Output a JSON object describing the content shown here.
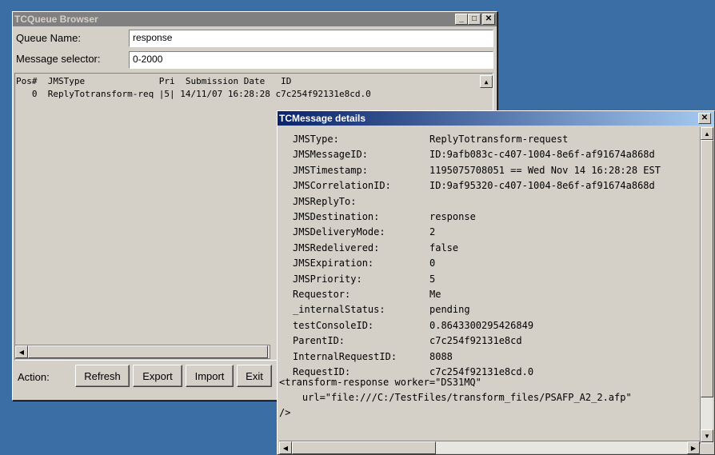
{
  "queue_browser": {
    "title": "TCQueue Browser",
    "queue_name_label": "Queue Name:",
    "queue_name_value": "response",
    "selector_label": "Message selector:",
    "selector_value": "0-2000",
    "list_header": "Pos#  JMSType              Pri  Submission Date   ID",
    "rows": [
      "   0  ReplyTotransform-req |5| 14/11/07 16:28:28 c7c254f92131e8cd.0"
    ],
    "action_label": "Action:",
    "buttons": {
      "refresh": "Refresh",
      "export": "Export",
      "import": "Import",
      "exit": "Exit"
    },
    "window_controls": {
      "minimize": "_",
      "maximize": "□",
      "close": "✕"
    }
  },
  "message_details": {
    "title": "TCMessage details",
    "fields": [
      {
        "key": "JMSType:",
        "value": "ReplyTotransform-request"
      },
      {
        "key": "JMSMessageID:",
        "value": "ID:9afb083c-c407-1004-8e6f-af91674a868d"
      },
      {
        "key": "JMSTimestamp:",
        "value": "1195075708051 == Wed Nov 14 16:28:28 EST"
      },
      {
        "key": "JMSCorrelationID:",
        "value": "ID:9af95320-c407-1004-8e6f-af91674a868d"
      },
      {
        "key": "JMSReplyTo:",
        "value": ""
      },
      {
        "key": "JMSDestination:",
        "value": "response"
      },
      {
        "key": "JMSDeliveryMode:",
        "value": "2"
      },
      {
        "key": "JMSRedelivered:",
        "value": "false"
      },
      {
        "key": "JMSExpiration:",
        "value": "0"
      },
      {
        "key": "JMSPriority:",
        "value": "5"
      },
      {
        "key": "Requestor:",
        "value": "Me"
      },
      {
        "key": "_internalStatus:",
        "value": "pending"
      },
      {
        "key": "testConsoleID:",
        "value": "0.8643300295426849"
      },
      {
        "key": "ParentID:",
        "value": "c7c254f92131e8cd"
      },
      {
        "key": "InternalRequestID:",
        "value": "8088"
      },
      {
        "key": "RequestID:",
        "value": "c7c254f92131e8cd.0"
      }
    ],
    "body_line1": "<transform-response worker=\"DS31MQ\"",
    "body_line2": "    url=\"file:///C:/TestFiles/transform_files/PSAFP_A2_2.afp\"",
    "body_line3": "/>",
    "close_glyph": "✕"
  }
}
